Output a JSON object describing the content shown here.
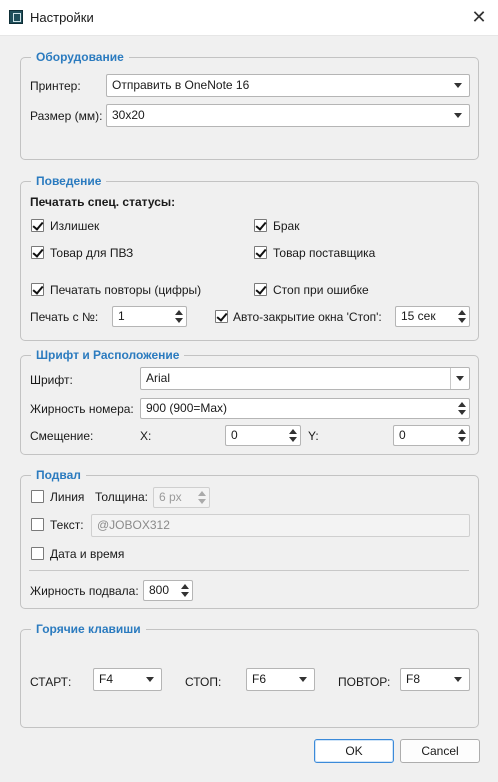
{
  "window": {
    "title": "Настройки",
    "app_icon": "app-icon",
    "close_icon": "close-icon",
    "close_glyph": "✕"
  },
  "equipment": {
    "title": "Оборудование",
    "printer_label": "Принтер:",
    "printer_value": "Отправить в OneNote 16",
    "size_label": "Размер (мм):",
    "size_value": "30x20"
  },
  "behavior": {
    "title": "Поведение",
    "statuses_label": "Печатать спец. статусы:",
    "checks": {
      "surplus": {
        "label": "Излишек",
        "checked": true
      },
      "defect": {
        "label": "Брак",
        "checked": true
      },
      "pvz_item": {
        "label": "Товар для ПВЗ",
        "checked": true
      },
      "supplier_item": {
        "label": "Товар поставщика",
        "checked": true
      },
      "print_repeats": {
        "label": "Печатать повторы (цифры)",
        "checked": true
      },
      "stop_on_error": {
        "label": "Стоп при ошибке",
        "checked": true
      },
      "auto_close": {
        "label": "Авто-закрытие окна 'Стоп':",
        "checked": true
      }
    },
    "print_from_label": "Печать с №:",
    "print_from_value": "1",
    "auto_close_value": "15 сек"
  },
  "font": {
    "title": "Шрифт и Расположение",
    "font_label": "Шрифт:",
    "font_value": "Arial",
    "weight_label": "Жирность номера:",
    "weight_value": "900 (900=Max)",
    "offset_label": "Смещение:",
    "x_label": "X:",
    "x_value": "0",
    "y_label": "Y:",
    "y_value": "0"
  },
  "footer": {
    "title": "Подвал",
    "line_label": "Линия",
    "line_checked": false,
    "thickness_label": "Толщина:",
    "thickness_value": "6 px",
    "text_label": "Текст:",
    "text_checked": false,
    "text_value": "@JOBOX312",
    "datetime_label": "Дата и время",
    "datetime_checked": false,
    "weight_label": "Жирность подвала:",
    "weight_value": "800"
  },
  "hotkeys": {
    "title": "Горячие клавиши",
    "start_label": "СТАРТ:",
    "start_value": "F4",
    "stop_label": "СТОП:",
    "stop_value": "F6",
    "repeat_label": "ПОВТОР:",
    "repeat_value": "F8"
  },
  "buttons": {
    "ok": "OK",
    "cancel": "Cancel"
  }
}
